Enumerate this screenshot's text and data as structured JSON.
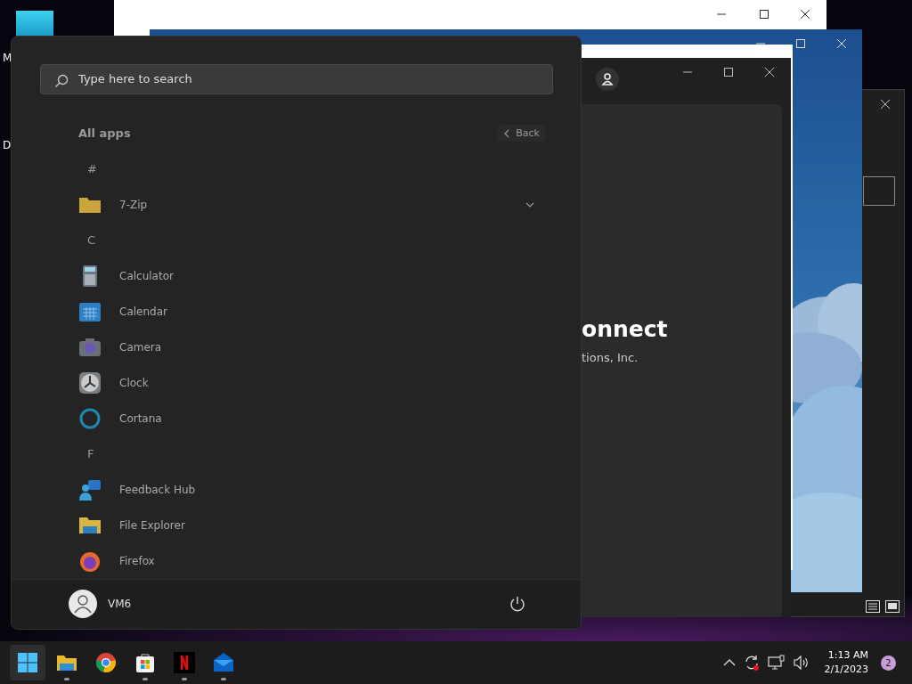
{
  "desktop": {
    "icons": [
      {
        "label": "M"
      },
      {
        "label": "D"
      }
    ]
  },
  "connect_window": {
    "heading": "onnect",
    "subheading": "tions, Inc."
  },
  "start_menu": {
    "search": {
      "placeholder": "Type here to search"
    },
    "title": "All apps",
    "back": "Back",
    "groups": [
      {
        "letter": "#",
        "apps": [
          {
            "name": "7-Zip",
            "kind": "folder"
          }
        ]
      },
      {
        "letter": "C",
        "apps": [
          {
            "name": "Calculator",
            "kind": "app"
          },
          {
            "name": "Calendar",
            "kind": "app"
          },
          {
            "name": "Camera",
            "kind": "app"
          },
          {
            "name": "Clock",
            "kind": "app"
          },
          {
            "name": "Cortana",
            "kind": "app"
          }
        ]
      },
      {
        "letter": "F",
        "apps": [
          {
            "name": "Feedback Hub",
            "kind": "app"
          },
          {
            "name": "File Explorer",
            "kind": "app"
          },
          {
            "name": "Firefox",
            "kind": "app"
          }
        ]
      }
    ],
    "user": "VM6"
  },
  "taskbar": {
    "start_selected": true,
    "apps": [
      {
        "running": true
      },
      {
        "running": false
      },
      {
        "running": true
      },
      {
        "running": true
      },
      {
        "running": true
      }
    ],
    "time": "1:13 AM",
    "date": "2/1/2023",
    "notifications": "2"
  }
}
